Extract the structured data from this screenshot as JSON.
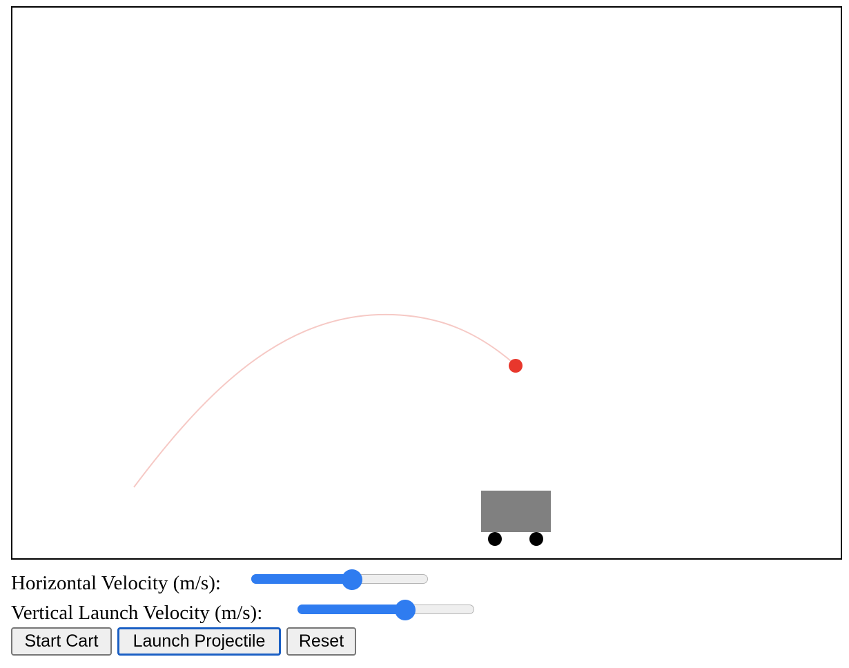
{
  "controls": {
    "horizontal_velocity": {
      "label": "Horizontal Velocity (m/s):",
      "value_fraction": 0.57
    },
    "vertical_velocity": {
      "label": "Vertical Launch Velocity (m/s):",
      "value_fraction": 0.61
    }
  },
  "buttons": {
    "start_cart": "Start Cart",
    "launch_projectile": "Launch Projectile",
    "reset": "Reset"
  },
  "colors": {
    "projectile": "#e8372c",
    "trajectory": "#f6c9c5",
    "cart_body": "#808080",
    "wheel": "#000000",
    "slider_accent": "#2f7cf0",
    "focus_ring": "#1a5fc4"
  }
}
